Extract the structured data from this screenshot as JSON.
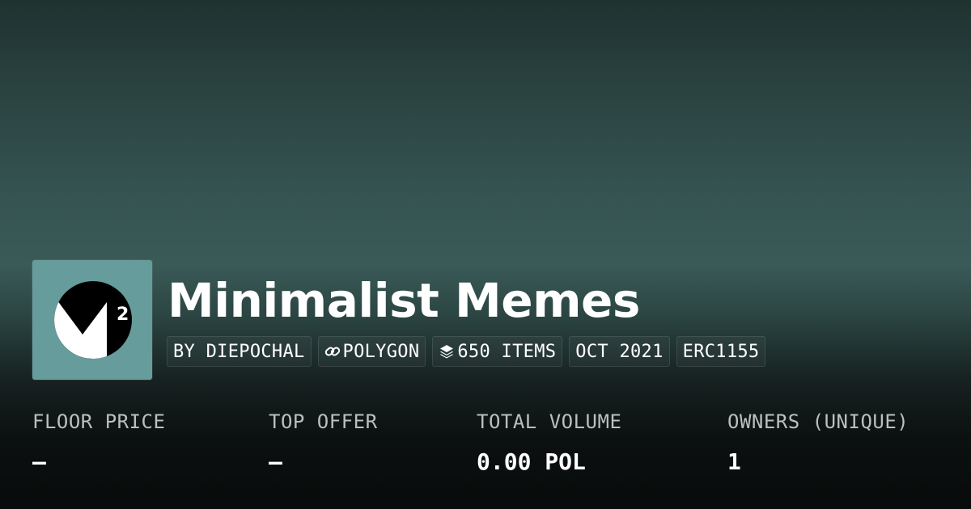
{
  "collection": {
    "name": "Minimalist Memes",
    "logo_superscript": "2",
    "logo_bg_color": "#669c9b",
    "logo_icon": "m-squared-logo-icon"
  },
  "tags": [
    {
      "label": "BY DIEPOCHAL",
      "icon": ""
    },
    {
      "label": "POLYGON",
      "icon": "link-icon"
    },
    {
      "label": "650 ITEMS",
      "icon": "layers-icon"
    },
    {
      "label": "OCT 2021",
      "icon": ""
    },
    {
      "label": "ERC1155",
      "icon": ""
    }
  ],
  "stats": [
    {
      "label": "FLOOR PRICE",
      "value": "–"
    },
    {
      "label": "TOP OFFER",
      "value": "–"
    },
    {
      "label": "TOTAL VOLUME",
      "value": "0.00 POL"
    },
    {
      "label": "OWNERS (UNIQUE)",
      "value": "1"
    }
  ],
  "colors": {
    "background_top": "#1f3230",
    "background_mid": "#3a5a57",
    "background_bottom": "#090b0b",
    "text": "#ffffff",
    "muted_text": "#b8c0c0"
  }
}
